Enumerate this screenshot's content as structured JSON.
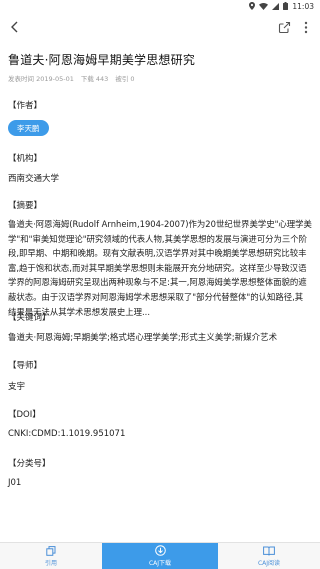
{
  "status_bar": {
    "time": "11:03"
  },
  "article": {
    "title": "鲁道夫·阿恩海姆早期美学思想研究",
    "publish_time": "发表时间 2019-05-01",
    "downloads": "下载 443",
    "citations": "被引 0"
  },
  "sections": {
    "author_label": "【作者】",
    "author_name": "李天鹏",
    "institution_label": "【机构】",
    "institution": "西南交通大学",
    "abstract_label": "【摘要】",
    "abstract_lines": [
      "鲁道夫·阿恩海姆(Rudolf Arnheim,1904-2007)作为20世纪世界美学史\"心理学美",
      "学\"和\"审美知觉理论\"研究领域的代表人物,其美学思想的发展与演进可分为三个阶",
      "段,即早期、中期和晚期。现有文献表明,汉语学界对其中晚期美学思想研究比较丰",
      "富,趋于饱和状态,而对其早期美学思想则未能展开充分地研究。这样至少导致汉语",
      "学界的阿恩海姆研究呈现出两种现象与不足:其一,阿恩海姆美学思想整体面貌的遮",
      "蔽状态。由于汉语学界对阿恩海姆学术思想采取了\"部分代替整体\"的认知路径,其",
      "结果是无法从其学术思想发展史上理..."
    ],
    "keywords_label": "【关键词】",
    "keywords": "鲁道夫·阿恩海姆;早期美学;格式塔心理学美学;形式主义美学;新媒介艺术",
    "advisor_label": "【导师】",
    "advisor": "支宇",
    "doi_label": "【DOI】",
    "doi": "CNKI:CDMD:1.1019.951071",
    "classification_label": "【分类号】",
    "classification": "J01"
  },
  "tabs": [
    {
      "label": "引用",
      "icon": "copy-icon"
    },
    {
      "label": "CAJ下载",
      "icon": "download-icon"
    },
    {
      "label": "CAJ阅读",
      "icon": "book-icon"
    }
  ],
  "colors": {
    "accent": "#3d9be9",
    "tab_text": "#4a8fd8",
    "meta": "#9a9a9a"
  }
}
